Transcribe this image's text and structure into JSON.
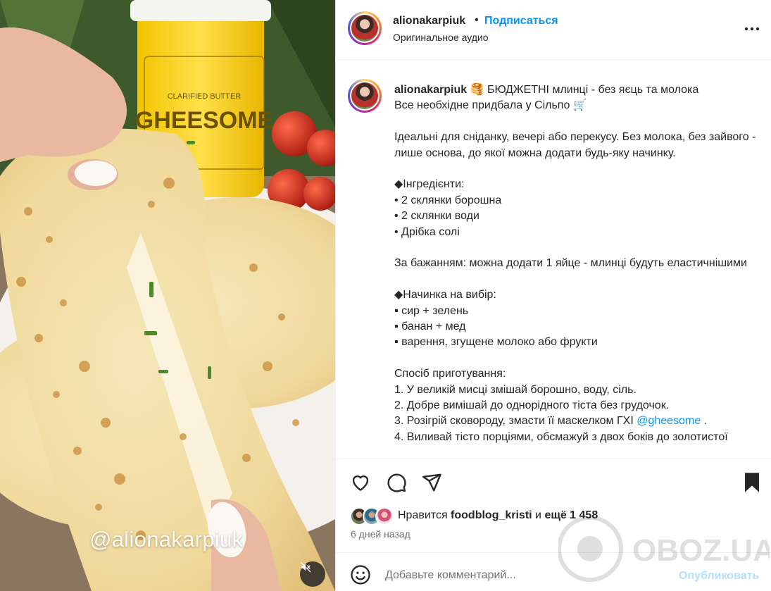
{
  "post": {
    "username": "alionakarpiuk",
    "follow_label": "Подписаться",
    "audio_label": "Оригинальное аудио",
    "more_icon": "more-horizontal-icon"
  },
  "media": {
    "watermark": "@alionakarpiuk",
    "mute_icon": "volume-muted-icon",
    "jar_label_line1": "CLARIFIED BUTTER",
    "jar_label_line2": "GHEESOME"
  },
  "caption": {
    "username": "alionakarpiuk",
    "first_line_emoji": "🥞",
    "first_line_text": "БЮДЖЕТНІ млинці - без яєць та молока",
    "lines": [
      "Все необхідне придбала у Сільпо 🛒",
      "",
      "Ідеальні для сніданку, вечері або перекусу. Без молока, без зайвого - лише основа, до якої можна додати будь-яку начинку.",
      "",
      "◆Інгредієнти:",
      "• 2 склянки борошна",
      "• 2 склянки води",
      "• Дрібка солі",
      "",
      "За бажанням: можна додати 1 яйце - млинці будуть еластичнішими",
      "",
      "◆Начинка на вибір:",
      "▪ сир + зелень",
      "▪ банан + мед",
      "▪ варення, згущене молоко або фрукти",
      "",
      "Спосіб приготування:",
      "1. У великій мисці змішай борошно, воду, сіль.",
      "2. Добре вимішай до однорідного тіста без грудочок.",
      "3. Розігрій сковороду, змасти її маскелком ГХІ ",
      "4. Виливай тісто порціями, обсмажуй з двох боків до золотистої"
    ],
    "mention": "@gheesome",
    "mention_suffix": " ."
  },
  "actions": {
    "like_icon": "heart-icon",
    "comment_icon": "comment-icon",
    "share_icon": "share-icon",
    "save_icon": "bookmark-icon"
  },
  "likes": {
    "prefix": "Нравится ",
    "user": "foodblog_kristi",
    "middle": " и ",
    "count_text": "ещё 1 458"
  },
  "timestamp": "6 дней назад",
  "comment": {
    "placeholder": "Добавьте комментарий...",
    "publish_label": "Опубликовать",
    "emoji_icon": "emoji-smile-icon"
  },
  "overlay_watermark": "OBOZ.UA",
  "colors": {
    "accent_blue": "#0095f6",
    "publish_disabled": "#b2dffc",
    "text_primary": "#262626",
    "text_secondary": "#737373"
  }
}
